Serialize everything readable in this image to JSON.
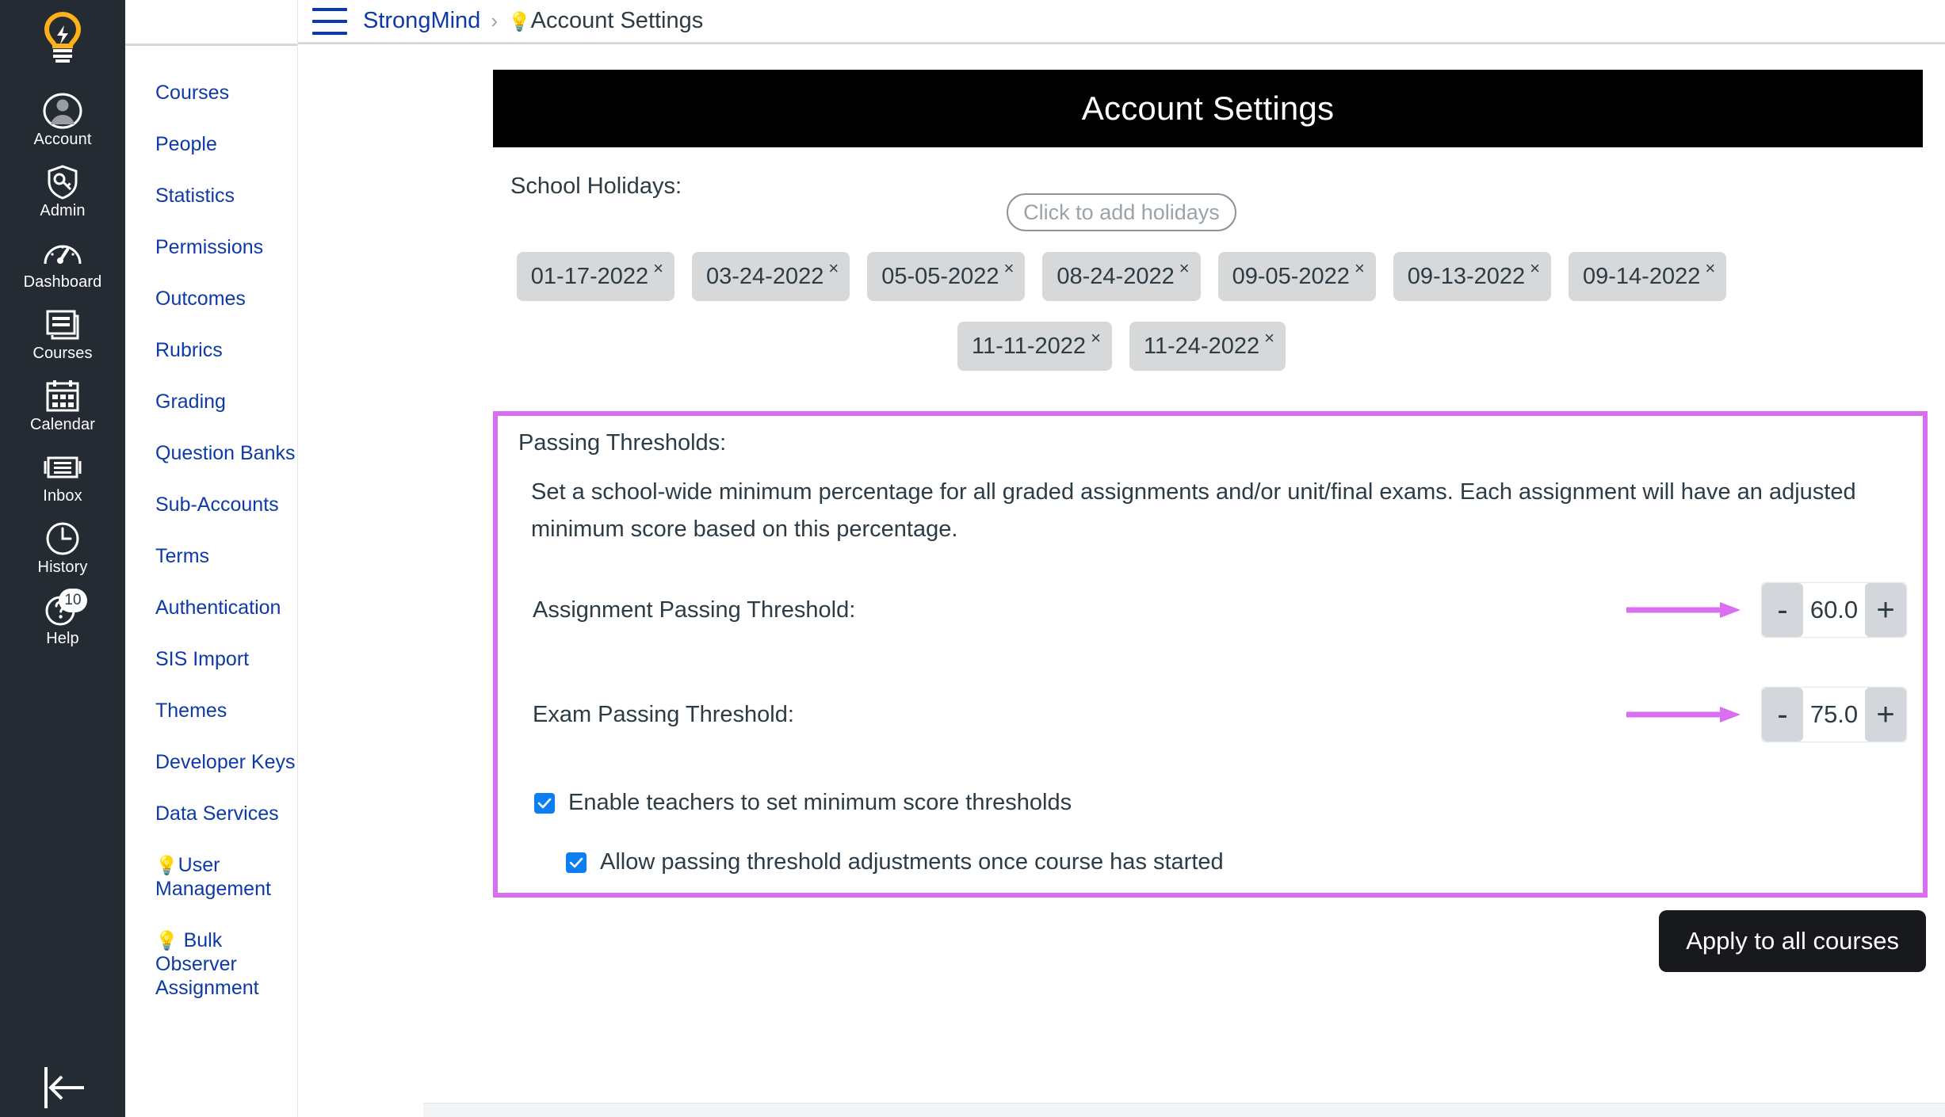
{
  "globalnav": {
    "logo_icon": "lightbulb-logo-icon",
    "items": [
      {
        "label": "Account",
        "icon": "user-avatar-icon"
      },
      {
        "label": "Admin",
        "icon": "shield-key-icon"
      },
      {
        "label": "Dashboard",
        "icon": "speedometer-icon"
      },
      {
        "label": "Courses",
        "icon": "book-icon"
      },
      {
        "label": "Calendar",
        "icon": "calendar-icon"
      },
      {
        "label": "Inbox",
        "icon": "inbox-tray-icon"
      },
      {
        "label": "History",
        "icon": "clock-icon"
      },
      {
        "label": "Help",
        "icon": "question-circle-icon",
        "badge": "10"
      }
    ],
    "collapse_icon": "collapse-left-arrow-icon"
  },
  "subnav": {
    "items": [
      {
        "label": "Courses",
        "bulb": false
      },
      {
        "label": "People",
        "bulb": false
      },
      {
        "label": "Statistics",
        "bulb": false
      },
      {
        "label": "Permissions",
        "bulb": false
      },
      {
        "label": "Outcomes",
        "bulb": false
      },
      {
        "label": "Rubrics",
        "bulb": false
      },
      {
        "label": "Grading",
        "bulb": false
      },
      {
        "label": "Question Banks",
        "bulb": false
      },
      {
        "label": "Sub-Accounts",
        "bulb": false
      },
      {
        "label": "Terms",
        "bulb": false
      },
      {
        "label": "Authentication",
        "bulb": false
      },
      {
        "label": "SIS Import",
        "bulb": false
      },
      {
        "label": "Themes",
        "bulb": false
      },
      {
        "label": "Developer Keys",
        "bulb": false
      },
      {
        "label": "Data Services",
        "bulb": false
      },
      {
        "label": "User Management",
        "bulb": true
      },
      {
        "label": "Bulk Observer Assignment",
        "bulb": true
      }
    ]
  },
  "breadcrumb": {
    "menu_icon": "hamburger-menu-icon",
    "root": "StrongMind",
    "separator": "›",
    "current_bulb": "💡",
    "current": "Account Settings"
  },
  "banner": {
    "title": "Account Settings"
  },
  "holidays": {
    "label": "School Holidays:",
    "input_placeholder": "Click to add holidays",
    "remove_glyph": "×",
    "row1": [
      "01-17-2022",
      "03-24-2022",
      "05-05-2022",
      "08-24-2022",
      "09-05-2022",
      "09-13-2022",
      "09-14-2022"
    ],
    "row2": [
      "11-11-2022",
      "11-24-2022"
    ]
  },
  "thresholds": {
    "title": "Passing Thresholds:",
    "description": "Set a school-wide minimum percentage for all graded assignments and/or unit/final exams. Each assignment will have an adjusted minimum score based on this percentage.",
    "border_color": "#d96ef0",
    "arrow_color": "#d96ef0",
    "assignment": {
      "label": "Assignment Passing Threshold:",
      "minus": "-",
      "value": "60.0",
      "plus": "+"
    },
    "exam": {
      "label": "Exam Passing Threshold:",
      "minus": "-",
      "value": "75.0",
      "plus": "+"
    },
    "checkbox_1": {
      "label": "Enable teachers to set minimum score thresholds",
      "checked": true
    },
    "checkbox_2": {
      "label": "Allow passing threshold adjustments once course has started",
      "checked": true
    }
  },
  "footer": {
    "apply_label": "Apply to all courses"
  },
  "colors": {
    "link_blue": "#0e3aa8",
    "nav_dark": "#242b32",
    "accent_magenta": "#d96ef0",
    "checkbox_blue": "#0b7ef4",
    "banner_black": "#000000"
  }
}
